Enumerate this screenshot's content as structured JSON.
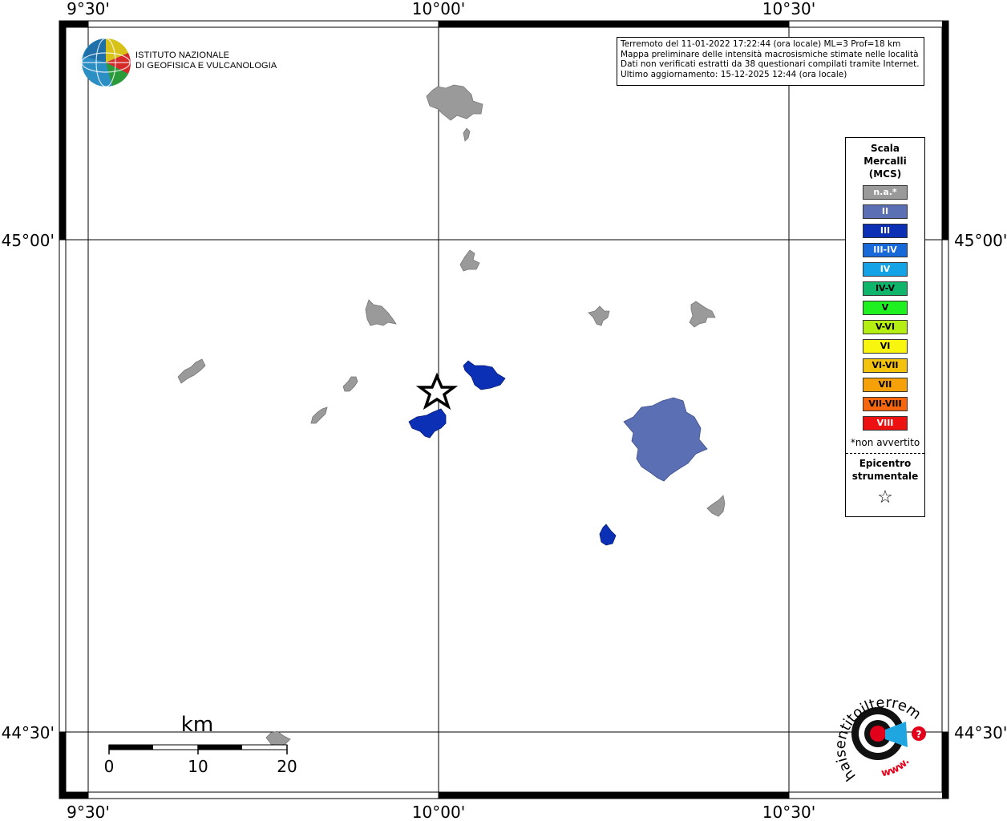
{
  "map": {
    "lon_labels": [
      "9°30'",
      "10°00'",
      "10°30'"
    ],
    "lat_labels": [
      "45°00'",
      "44°30'"
    ]
  },
  "institute": {
    "name_line1": "ISTITUTO NAZIONALE",
    "name_line2": "DI GEOFISICA E VULCANOLOGIA"
  },
  "info": {
    "line1": "Terremoto del 11-01-2022 17:22:44 (ora locale) ML=3 Prof=18 km",
    "line2": "Mappa preliminare delle intensità macrosismiche stimate nelle località",
    "line3": "Dati non verificati estratti da 38 questionari compilati tramite Internet.",
    "line4": "Ultimo aggiornamento: 15-12-2025 12:44 (ora locale)"
  },
  "legend": {
    "title_line1": "Scala",
    "title_line2": "Mercalli",
    "title_line3": "(MCS)",
    "items": [
      {
        "label": "n.a.*",
        "color": "#9a9a9a",
        "text_color": "#ffffff"
      },
      {
        "label": "II",
        "color": "#5b6fb5",
        "text_color": "#ffffff"
      },
      {
        "label": "III",
        "color": "#0b2fb5",
        "text_color": "#ffffff"
      },
      {
        "label": "III-IV",
        "color": "#1768d8",
        "text_color": "#ffffff"
      },
      {
        "label": "IV",
        "color": "#14a3e6",
        "text_color": "#ffffff"
      },
      {
        "label": "IV-V",
        "color": "#0eb56a",
        "text_color": "#000000"
      },
      {
        "label": "V",
        "color": "#1ff01f",
        "text_color": "#000000"
      },
      {
        "label": "V-VI",
        "color": "#b4ee12",
        "text_color": "#000000"
      },
      {
        "label": "VI",
        "color": "#f8f50e",
        "text_color": "#000000"
      },
      {
        "label": "VI-VII",
        "color": "#f3c20d",
        "text_color": "#000000"
      },
      {
        "label": "VII",
        "color": "#f7a10a",
        "text_color": "#000000"
      },
      {
        "label": "VII-VIII",
        "color": "#f7650c",
        "text_color": "#000000"
      },
      {
        "label": "VIII",
        "color": "#ee1111",
        "text_color": "#ffffff"
      }
    ],
    "note": "*non avvertito",
    "epicenter_line1": "Epicentro",
    "epicenter_line2": "strumentale",
    "epicenter_symbol": "☆"
  },
  "scale_bar": {
    "unit": "km",
    "ticks": [
      "0",
      "10",
      "20"
    ]
  },
  "brand": {
    "text": "haisentitoilterremoto.it",
    "www": "www.",
    "accent": "#e2001a"
  },
  "colors": {
    "na": "#9a9a9a",
    "II": "#5b6fb5",
    "III": "#0b2fb5"
  }
}
